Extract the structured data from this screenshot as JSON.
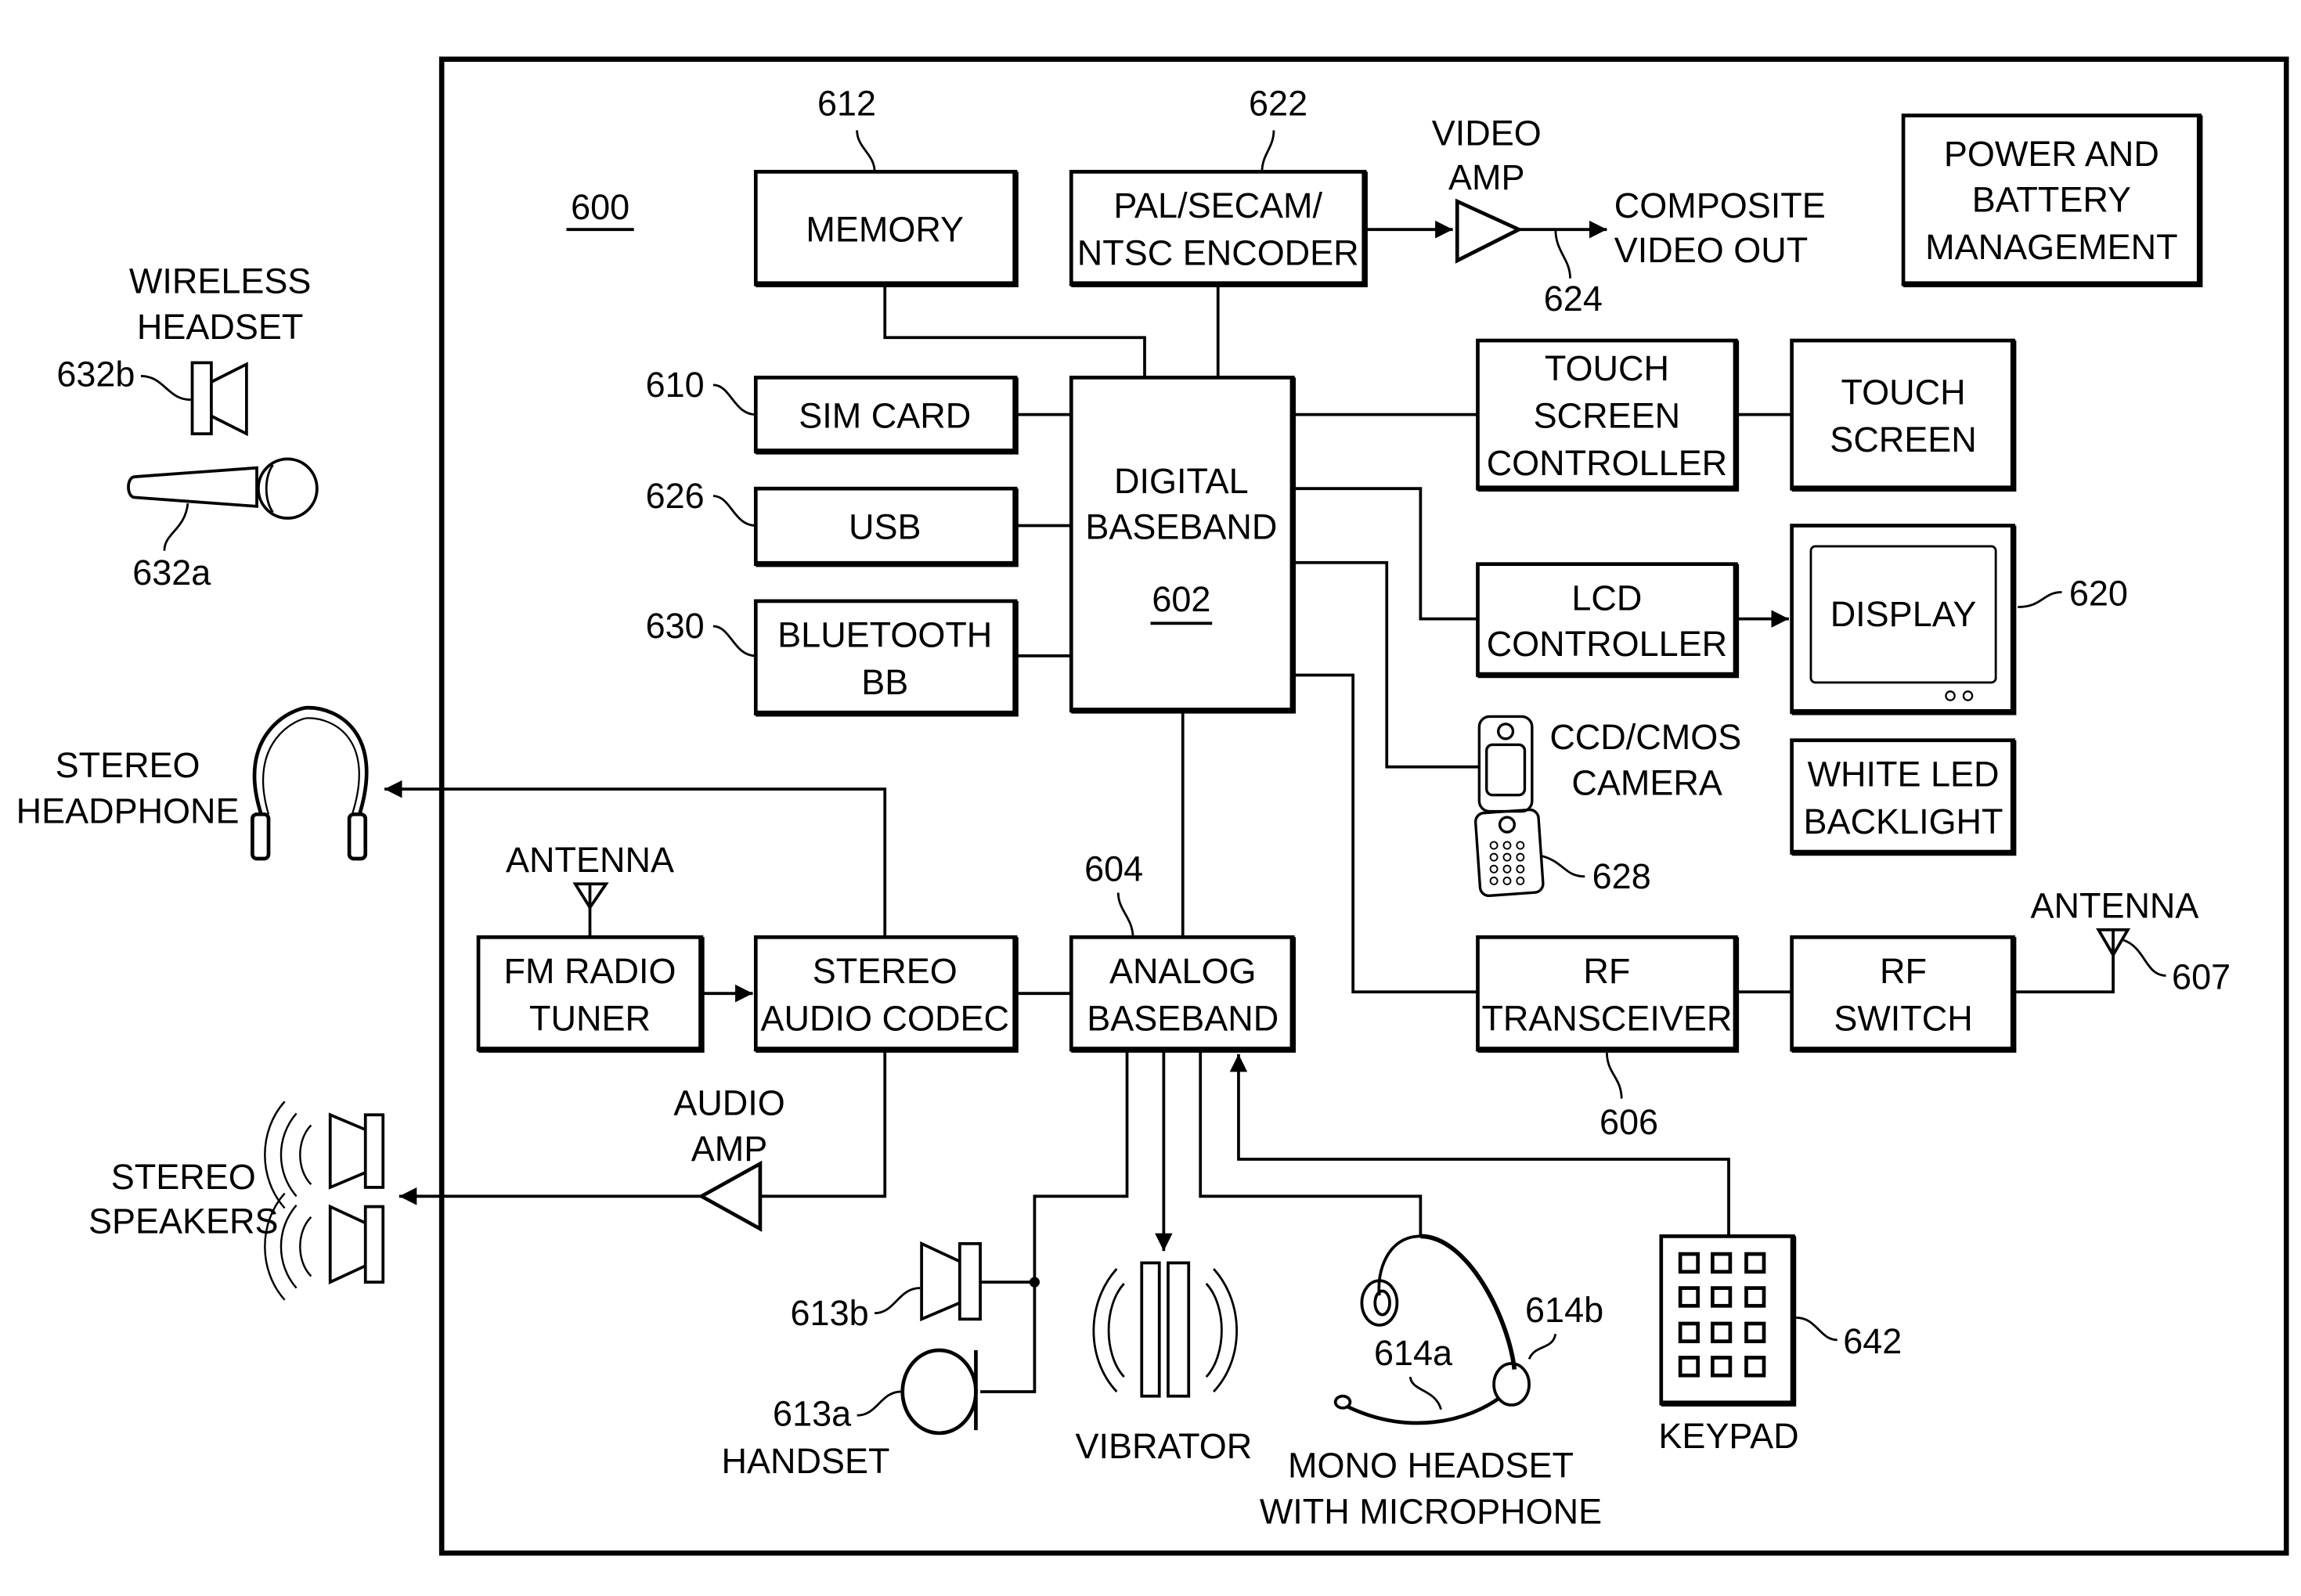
{
  "figure_number": "600",
  "blocks": {
    "memory": {
      "label": [
        "MEMORY"
      ],
      "ref": "612"
    },
    "encoder": {
      "label": [
        "PAL/SECAM/",
        "NTSC ENCODER"
      ],
      "ref": "622"
    },
    "power": {
      "label": [
        "POWER AND",
        "BATTERY",
        "MANAGEMENT"
      ]
    },
    "sim": {
      "label": [
        "SIM CARD"
      ],
      "ref": "610"
    },
    "usb": {
      "label": [
        "USB"
      ],
      "ref": "626"
    },
    "bluetooth": {
      "label": [
        "BLUETOOTH",
        "BB"
      ],
      "ref": "630"
    },
    "digital_baseband": {
      "label": [
        "DIGITAL",
        "BASEBAND"
      ],
      "ref": "602"
    },
    "touch_controller": {
      "label": [
        "TOUCH",
        "SCREEN",
        "CONTROLLER"
      ]
    },
    "touch_screen": {
      "label": [
        "TOUCH",
        "SCREEN"
      ]
    },
    "lcd_controller": {
      "label": [
        "LCD",
        "CONTROLLER"
      ]
    },
    "display": {
      "label": [
        "DISPLAY"
      ],
      "ref": "620"
    },
    "backlight": {
      "label": [
        "WHITE LED",
        "BACKLIGHT"
      ]
    },
    "fm_tuner": {
      "label": [
        "FM RADIO",
        "TUNER"
      ]
    },
    "audio_codec": {
      "label": [
        "STEREO",
        "AUDIO CODEC"
      ]
    },
    "analog_baseband": {
      "label": [
        "ANALOG",
        "BASEBAND"
      ],
      "ref": "604"
    },
    "rf_transceiver": {
      "label": [
        "RF",
        "TRANSCEIVER"
      ],
      "ref": "606"
    },
    "rf_switch": {
      "label": [
        "RF",
        "SWITCH"
      ]
    }
  },
  "labels": {
    "video_amp": [
      "VIDEO",
      "AMP"
    ],
    "composite": [
      "COMPOSITE",
      "VIDEO OUT"
    ],
    "composite_ref": "624",
    "wireless_headset": [
      "WIRELESS",
      "HEADSET"
    ],
    "wireless_ref_b": "632b",
    "wireless_ref_a": "632a",
    "stereo_headphone": [
      "STEREO",
      "HEADPHONE"
    ],
    "fm_antenna": "ANTENNA",
    "rf_antenna": "ANTENNA",
    "rf_antenna_ref": "607",
    "audio_amp": [
      "AUDIO",
      "AMP"
    ],
    "stereo_speakers": [
      "STEREO",
      "SPEAKERS"
    ],
    "camera": [
      "CCD/CMOS",
      "CAMERA"
    ],
    "camera_ref": "628",
    "speaker_ref": "613b",
    "handset_ref": "613a",
    "handset": "HANDSET",
    "vibrator": "VIBRATOR",
    "mono_headset": [
      "MONO HEADSET",
      "WITH MICROPHONE"
    ],
    "mono_ref_a": "614a",
    "mono_ref_b": "614b",
    "keypad": "KEYPAD",
    "keypad_ref": "642"
  }
}
